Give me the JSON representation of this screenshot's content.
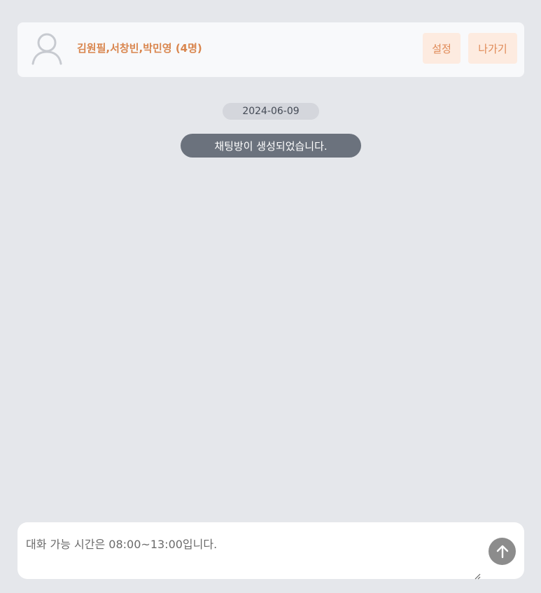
{
  "header": {
    "room_title": "김원필,서창빈,박민영 (4명)",
    "settings_label": "설정",
    "leave_label": "나가기",
    "avatar_icon": "user-avatar-icon"
  },
  "messages": {
    "date": "2024-06-09",
    "system_message": "채팅방이 생성되었습니다."
  },
  "composer": {
    "placeholder": "대화 가능 시간은 08:00~13:00입니다.",
    "value": "",
    "send_icon": "arrow-up-icon"
  },
  "colors": {
    "background": "#e5e7eb",
    "accent": "#d9864e",
    "button_bg": "#fdebe0",
    "system_pill": "#6b727d",
    "send_button": "#8c8c8c"
  }
}
